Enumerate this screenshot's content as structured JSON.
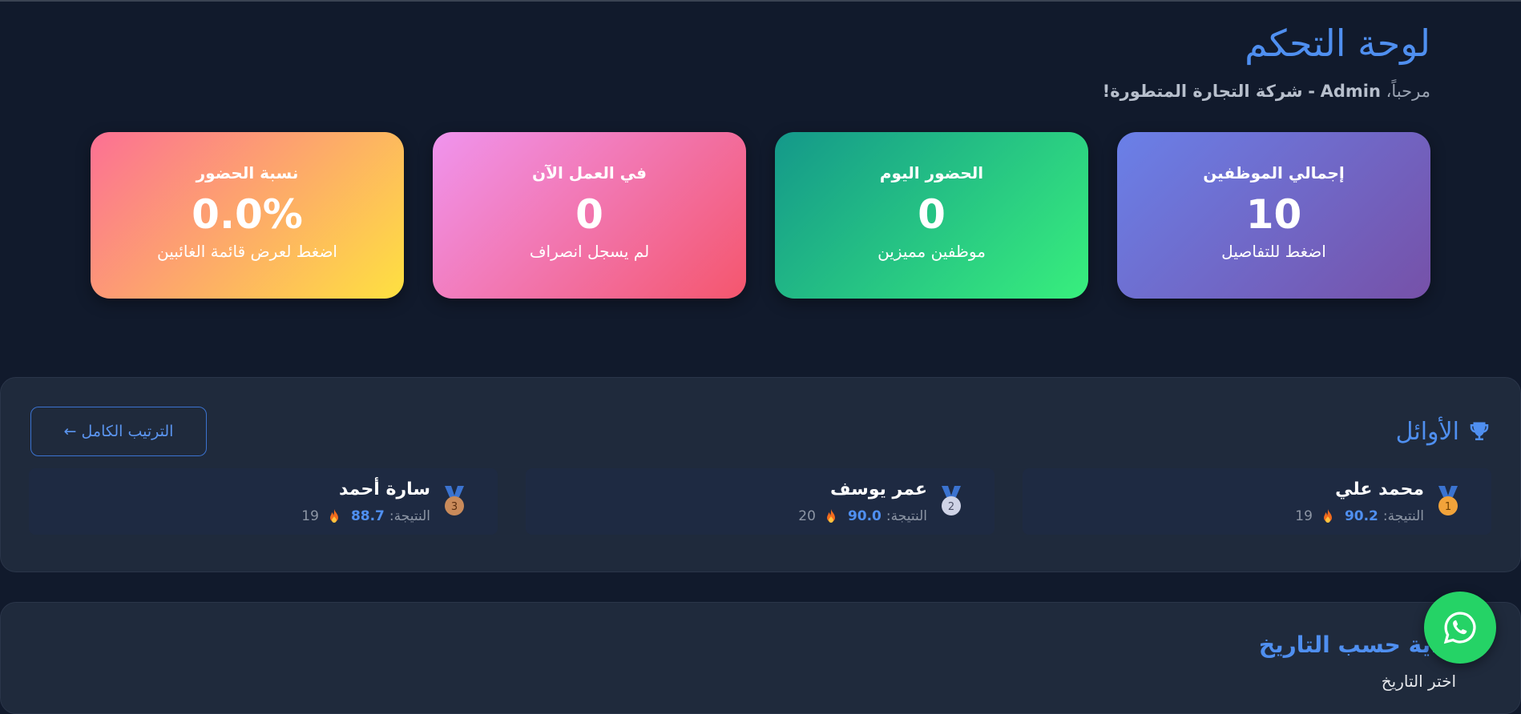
{
  "header": {
    "title": "لوحة التحكم",
    "welcome_prefix": "مرحباً،",
    "user": "Admin",
    "separator": "-",
    "company": "شركة التجارة المتطورة!"
  },
  "stats": [
    {
      "label": "إجمالي الموظفين",
      "value": "10",
      "sub": "اضغط للتفاصيل"
    },
    {
      "label": "الحضور اليوم",
      "value": "0",
      "sub": "موظفين مميزين"
    },
    {
      "label": "في العمل الآن",
      "value": "0",
      "sub": "لم يسجل انصراف"
    },
    {
      "label": "نسبة الحضور",
      "value": "0.0%",
      "sub": "اضغط لعرض قائمة الغائبين"
    }
  ],
  "leaders": {
    "title": "الأوائل",
    "full_ranking_button": "الترتيب الكامل ←",
    "score_label": "النتيجة:",
    "items": [
      {
        "rank": "1",
        "name": "محمد علي",
        "score": "90.2",
        "streak": "19"
      },
      {
        "rank": "2",
        "name": "عمر يوسف",
        "score": "90.0",
        "streak": "20"
      },
      {
        "rank": "3",
        "name": "سارة أحمد",
        "score": "88.7",
        "streak": "19"
      }
    ]
  },
  "section2": {
    "title": "...ية حسب التاريخ",
    "subtitle": "اختر التاريخ"
  },
  "colors": {
    "background": "#111a2c",
    "panel": "#1f2a3c",
    "accent": "#4f8ff0",
    "gold": "#f2a33a",
    "silver": "#cfd3e6",
    "bronze": "#c98a5a",
    "whatsapp": "#25d366"
  },
  "icons": {
    "leaders": "trophy-icon",
    "medal": "medal-icon",
    "streak": "flame-icon",
    "chat": "whatsapp-icon"
  }
}
